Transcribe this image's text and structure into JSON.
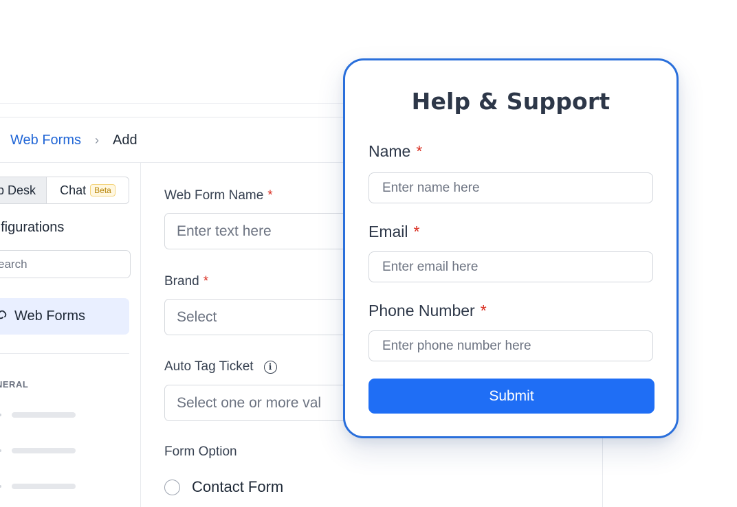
{
  "breadcrumb": {
    "link": "Web Forms",
    "separator": "›",
    "current": "Add"
  },
  "sidebar": {
    "tabs": [
      {
        "label": "p Desk"
      },
      {
        "label": "Chat",
        "badge": "Beta"
      }
    ],
    "heading": "nfigurations",
    "search_placeholder": "earch",
    "active_item": "Web Forms",
    "section_label": "NERAL"
  },
  "form": {
    "web_form_name": {
      "label": "Web Form Name",
      "required": "*",
      "placeholder": "Enter text here"
    },
    "brand": {
      "label": "Brand",
      "required": "*",
      "placeholder": "Select"
    },
    "auto_tag": {
      "label": "Auto Tag Ticket",
      "info_icon": "i",
      "placeholder": "Select one or more val"
    },
    "form_option": {
      "label": "Form Option",
      "option": "Contact Form"
    }
  },
  "card": {
    "title": "Help & Support",
    "fields": [
      {
        "label": "Name",
        "required": "*",
        "placeholder": "Enter name here"
      },
      {
        "label": "Email",
        "required": "*",
        "placeholder": "Enter email here"
      },
      {
        "label": "Phone Number",
        "required": "*",
        "placeholder": "Enter phone number here"
      }
    ],
    "submit_label": "Submit"
  },
  "colors": {
    "accent": "#1f6ef5",
    "card_border": "#2a6fdb",
    "link": "#2166d6",
    "required": "#d92d20"
  }
}
